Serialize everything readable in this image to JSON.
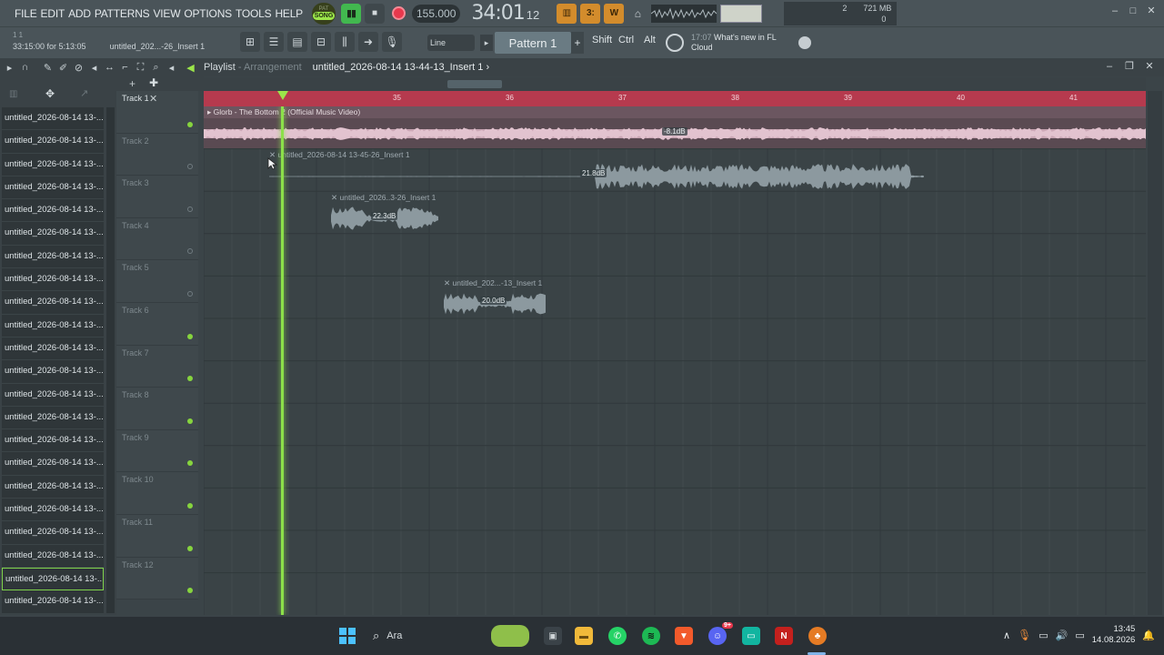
{
  "menu": [
    "FILE",
    "EDIT",
    "ADD",
    "PATTERNS",
    "VIEW",
    "OPTIONS",
    "TOOLS",
    "HELP"
  ],
  "transport": {
    "mode_pat": "PAT",
    "mode_song": "SONG",
    "tempo": "155.000",
    "time_main": "34:01",
    "time_sub": "12",
    "time_unit": "B:S:T"
  },
  "stats": {
    "voices": "2",
    "memory": "721 MB",
    "cpu": "0"
  },
  "hint": {
    "row1": "1   1",
    "time": "33:15:00 for 5:13:05",
    "clip": "untitled_202...-26_Insert 1"
  },
  "toolbar": {
    "snap": "Line",
    "pattern": "Pattern 1",
    "pattern_add": "+",
    "keys": [
      "Shift",
      "Ctrl",
      "Alt"
    ],
    "news_time": "17:07",
    "news_text": "What's new in FL Cloud"
  },
  "playlist": {
    "title": "Playlist",
    "title_sep": "-",
    "subtitle": "Arrangement",
    "clip_name": "untitled_2026-08-14 13-44-13_Insert 1",
    "clip_arrow": "›"
  },
  "browser_items": [
    "untitled_2026-08-14 13-...",
    "untitled_2026-08-14 13-...",
    "untitled_2026-08-14 13-...",
    "untitled_2026-08-14 13-...",
    "untitled_2026-08-14 13-...",
    "untitled_2026-08-14 13-...",
    "untitled_2026-08-14 13-...",
    "untitled_2026-08-14 13-...",
    "untitled_2026-08-14 13-...",
    "untitled_2026-08-14 13-...",
    "untitled_2026-08-14 13-...",
    "untitled_2026-08-14 13-...",
    "untitled_2026-08-14 13-...",
    "untitled_2026-08-14 13-...",
    "untitled_2026-08-14 13-...",
    "untitled_2026-08-14 13-...",
    "untitled_2026-08-14 13-...",
    "untitled_2026-08-14 13-...",
    "untitled_2026-08-14 13-...",
    "untitled_2026-08-14 13-...",
    "untitled_2026-08-14 13-...",
    "untitled_2026-08-14 13-..."
  ],
  "tracks": [
    "Track 1",
    "Track 2",
    "Track 3",
    "Track 4",
    "Track 5",
    "Track 6",
    "Track 7",
    "Track 8",
    "Track 9",
    "Track 10",
    "Track 11",
    "Track 12"
  ],
  "bars": [
    "35",
    "36",
    "37",
    "38",
    "39",
    "40",
    "41"
  ],
  "clips": {
    "track1": {
      "label": "Glorb - The Bottom 2 (Official Music Video)",
      "gain": "-8.1dB"
    },
    "track2": {
      "label": "untitled_2026-08-14 13-45-26_Insert 1",
      "gain": "21.8dB"
    },
    "track3": {
      "label": "untitled_2026..3-26_Insert 1",
      "gain": "22.3dB"
    },
    "track5": {
      "label": "untitled_202...-13_Insert 1",
      "gain": "20.0dB"
    }
  },
  "taskbar": {
    "search_placeholder": "Ara",
    "discord_badge": "9+",
    "time": "13:45",
    "date": "14.08.2026"
  },
  "colors": {
    "accent_green": "#8ce04a",
    "ruler": "#b63a4e",
    "record": "#e8384d",
    "orange": "#d38c2c"
  }
}
